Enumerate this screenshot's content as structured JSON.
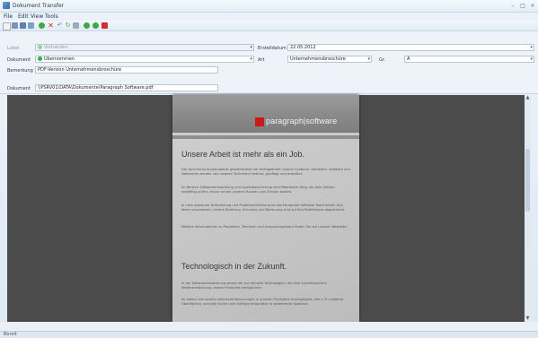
{
  "window": {
    "title": "Dokument Transfer"
  },
  "menu": [
    "File",
    "Edit",
    "View",
    "Tools"
  ],
  "form": {
    "label_label": "Label",
    "label_value": "Vorhanden",
    "dokument_label": "Dokument",
    "dokument_value": "Übernommen",
    "bemerkung_label": "Bemerkung",
    "bemerkung_value": "PDF-Version Unternehmensbroschüre",
    "dokument_path_label": "Dokument",
    "dokument_path_value": "\\\\PSRV01\\DATA\\Dokumente\\Paragraph Software.pdf",
    "erstellt_label": "Erstelldatum",
    "erstellt_value": "22.05.2012",
    "art_label": "Art",
    "art_value": "Unternehmensbroschüre",
    "size_label": "Gr.",
    "size_value": "A"
  },
  "document": {
    "logo_text": "paragraph|software",
    "heading1": "Unsere Arbeit ist mehr als ein Job.",
    "para1": "Der technische Kundendienst gewährleistet die Verfügbarkeit unserer Systeme. Hardware, Software und Netzwerke werden von unseren Technikern betreut, gepflegt und erweitert.",
    "para2": "Im Bereich Softwareentwicklung und Qualitätssicherung sind Mitarbeiter tätig, die jede Version sorgfältig prüfen, bevor sie bei unseren Kunden zum Einsatz kommt.",
    "para3": "Je nach geplanter Anforderung und Projektanforderung ist das Paragraph Software Team bereit, Ihre Ideen umzusetzen. Unsere Beratung, Schulung und Betreuung sind auf Ihre Bedürfnisse abgestimmt.",
    "para4": "Weitere Informationen zu Produkten, Terminen und Ansprechpartnern finden Sie auf unserer Webseite.",
    "heading2": "Technologisch in der Zukunft.",
    "para5": "In der Softwareentwicklung setzen wir auf aktuelle Technologien, die eine zukunftssichere Weiterentwicklung unserer Produkte ermöglichen.",
    "para6": "So haben sich bereits zahlreiche Neuerungen in unseren Produkten durchgesetzt, wie z. B. moderne Oberflächen, schnelle Suche und nahtlose Integration in bestehende Systeme."
  },
  "status": {
    "text": "Bereit"
  },
  "colors": {
    "accent": "#cc1a1a",
    "ok": "#3da84a",
    "viewer_bg": "#4b4b4b"
  }
}
